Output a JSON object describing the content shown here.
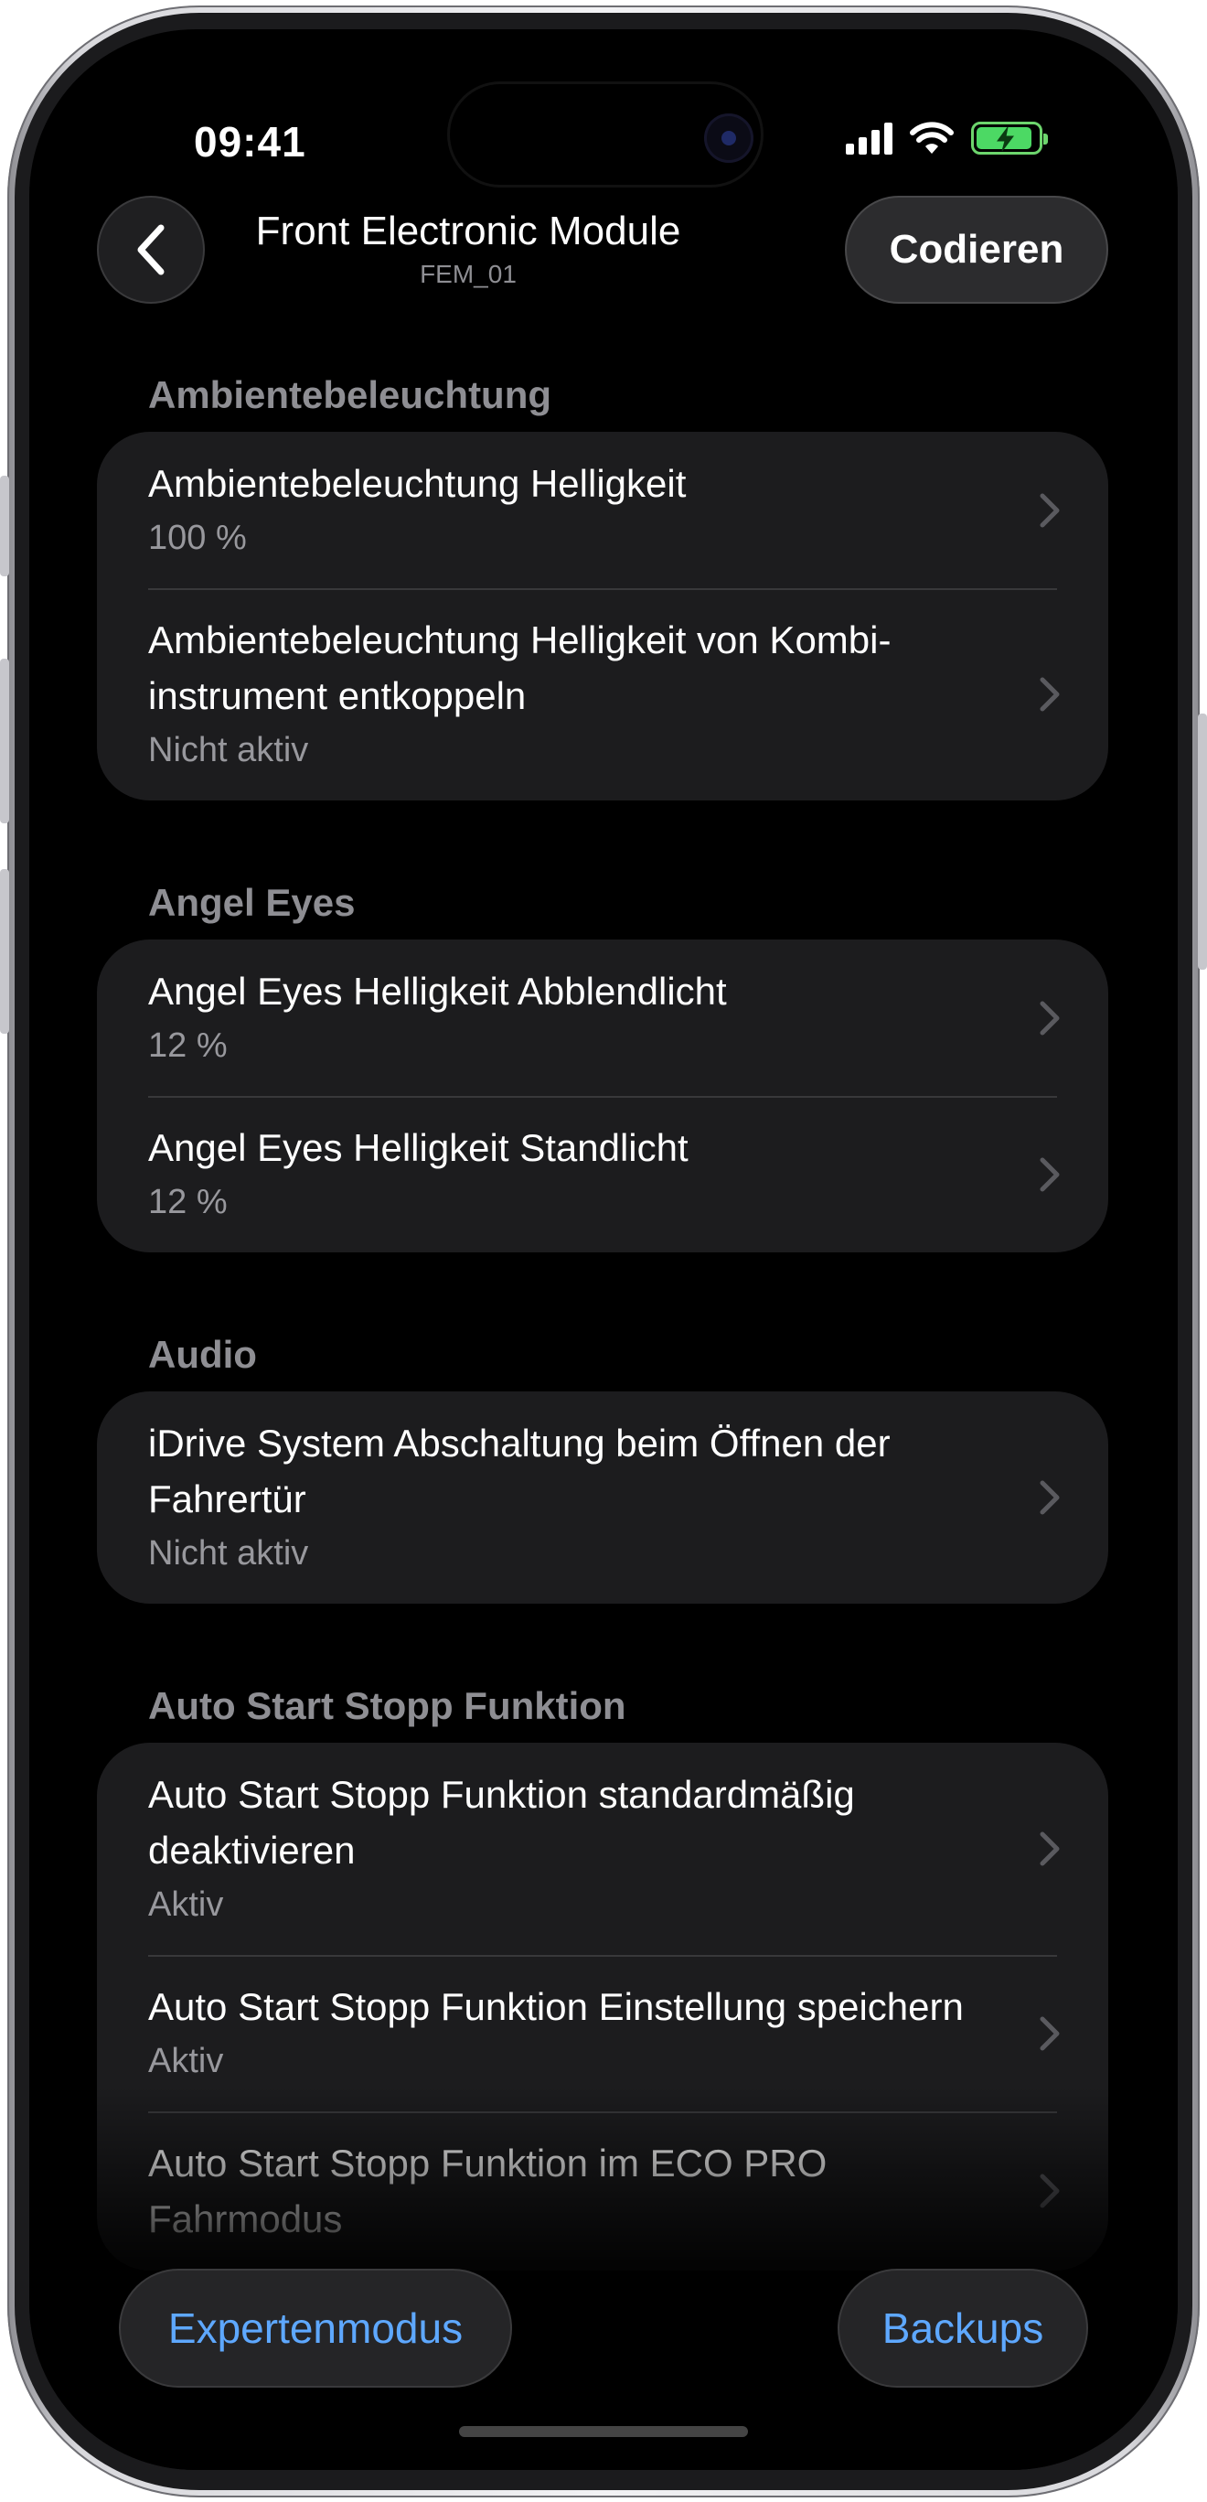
{
  "status_bar": {
    "time": "09:41"
  },
  "nav": {
    "title": "Front Electronic Module",
    "subtitle": "FEM_01",
    "action_label": "Codieren"
  },
  "sections": [
    {
      "header": "Ambientebeleuchtung",
      "rows": [
        {
          "title": "Ambientebeleuchtung Helligkeit",
          "value": "100 %"
        },
        {
          "title": "Ambientebeleuchtung Helligkeit von Kombi-instrument entkoppeln",
          "value": "Nicht aktiv"
        }
      ]
    },
    {
      "header": "Angel Eyes",
      "rows": [
        {
          "title": "Angel Eyes Helligkeit Abblendlicht",
          "value": "12 %"
        },
        {
          "title": "Angel Eyes Helligkeit Standlicht",
          "value": "12 %"
        }
      ]
    },
    {
      "header": "Audio",
      "rows": [
        {
          "title": "iDrive System Abschaltung beim Öffnen der Fahrertür",
          "value": "Nicht aktiv"
        }
      ]
    },
    {
      "header": "Auto Start Stopp Funktion",
      "rows": [
        {
          "title": "Auto Start Stopp Funktion standardmäßig deaktivieren",
          "value": "Aktiv"
        },
        {
          "title": "Auto Start Stopp Funktion Einstellung speichern",
          "value": "Aktiv"
        },
        {
          "title": "Auto Start Stopp Funktion im ECO PRO Fahrmodus",
          "value": ""
        }
      ]
    }
  ],
  "bottom_bar": {
    "left_label": "Expertenmodus",
    "right_label": "Backups"
  },
  "colors": {
    "background": "#000000",
    "group": "#1c1c1e",
    "accent": "#5ea8ff",
    "secondary_text": "#98989d",
    "battery": "#4cd964"
  },
  "icons": {
    "back": "chevron-left-icon",
    "row": "chevron-right-icon",
    "signal": "cellular-signal-icon",
    "wifi": "wifi-icon",
    "battery": "battery-charging-icon"
  }
}
